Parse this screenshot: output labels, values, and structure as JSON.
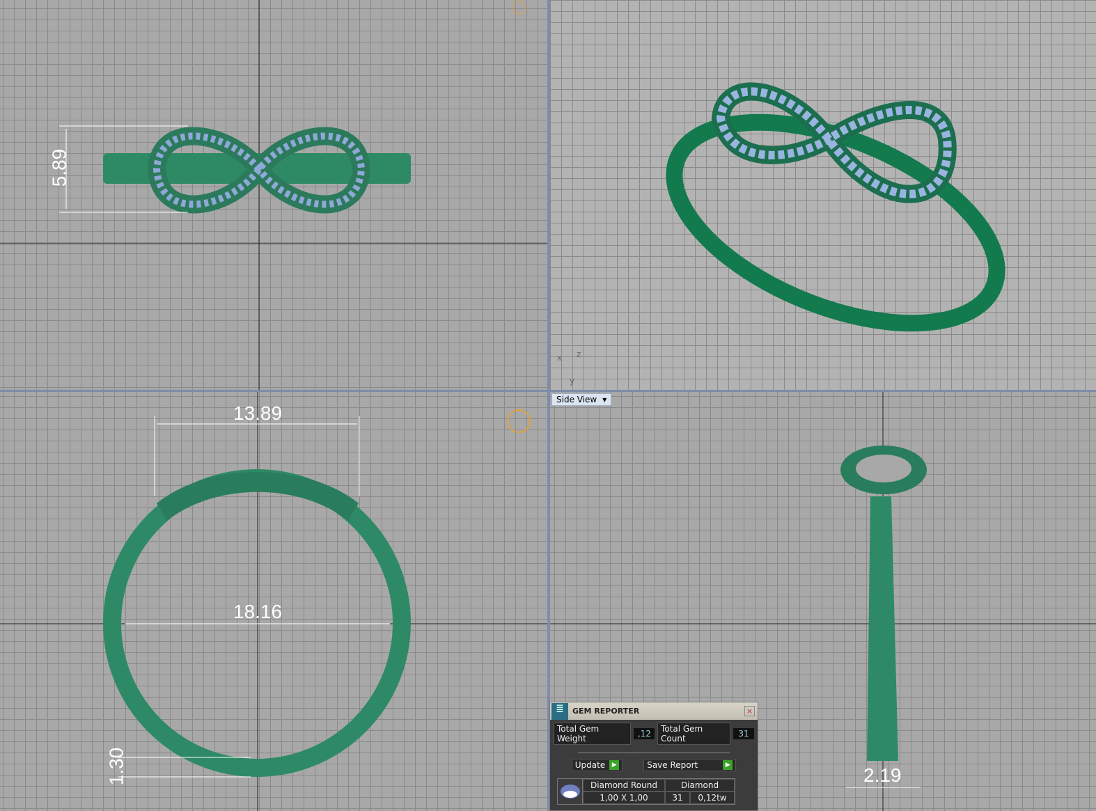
{
  "viewports": {
    "top_left": {
      "dimension": "5.89"
    },
    "top_right": {
      "axes": {
        "x": "x",
        "y": "y",
        "z": "z"
      }
    },
    "bottom_left": {
      "dimensions": {
        "width": "13.89",
        "inner_diameter": "18.16",
        "band_thickness": "1.30"
      }
    },
    "bottom_right": {
      "view_label": "Side View",
      "dimension": "2.19"
    }
  },
  "gem_reporter": {
    "title": "GEM REPORTER",
    "total_weight_label": "Total Gem Weight",
    "total_weight": ",12",
    "total_count_label": "Total Gem Count",
    "total_count": "31",
    "update_label": "Update",
    "save_label": "Save Report",
    "gems": [
      {
        "name": "Diamond Round",
        "material": "Diamond",
        "size": "1,00 X 1,00",
        "count": "31",
        "weight": "0,12tw"
      }
    ]
  },
  "colors": {
    "metal": "#2f8c68",
    "gem": "#8fa8d8",
    "grid": "#a8a8a8"
  }
}
